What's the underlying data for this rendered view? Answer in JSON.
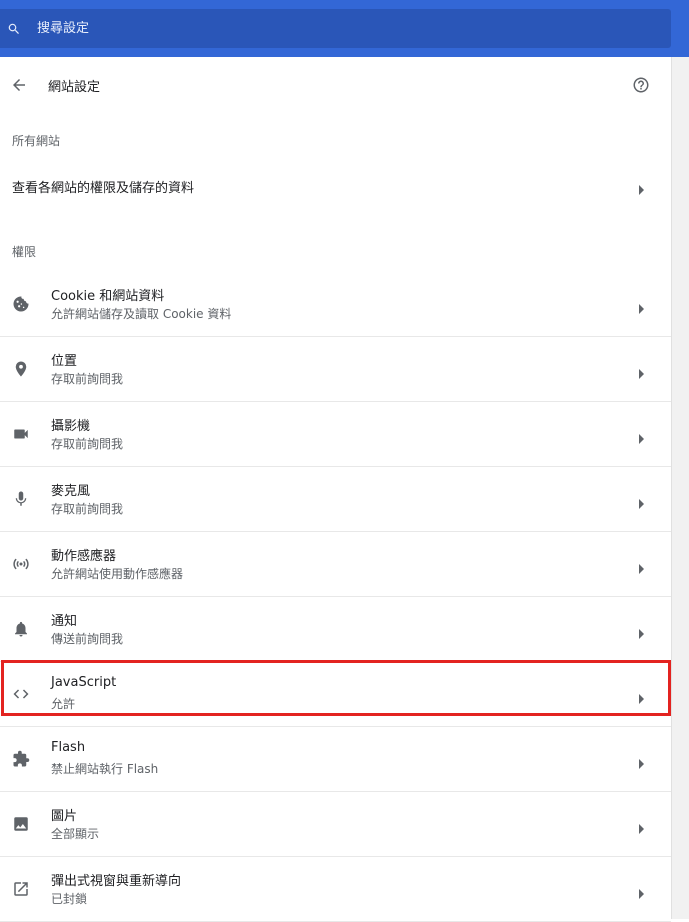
{
  "search": {
    "placeholder": "搜尋設定"
  },
  "header": {
    "title": "網站設定"
  },
  "sections": {
    "all_sites": {
      "label": "所有網站",
      "link_label": "查看各網站的權限及儲存的資料"
    },
    "permissions": {
      "label": "權限"
    }
  },
  "permissions": [
    {
      "icon": "cookie-icon",
      "title": "Cookie 和網站資料",
      "subtitle": "允許網站儲存及讀取 Cookie 資料"
    },
    {
      "icon": "location-pin-icon",
      "title": "位置",
      "subtitle": "存取前詢問我"
    },
    {
      "icon": "camera-icon",
      "title": "攝影機",
      "subtitle": "存取前詢問我"
    },
    {
      "icon": "microphone-icon",
      "title": "麥克風",
      "subtitle": "存取前詢問我"
    },
    {
      "icon": "motion-sensor-icon",
      "title": "動作感應器",
      "subtitle": "允許網站使用動作感應器"
    },
    {
      "icon": "bell-icon",
      "title": "通知",
      "subtitle": "傳送前詢問我"
    },
    {
      "icon": "code-icon",
      "title": "JavaScript",
      "subtitle": "允許"
    },
    {
      "icon": "puzzle-icon",
      "title": "Flash",
      "subtitle": "禁止網站執行 Flash"
    },
    {
      "icon": "image-icon",
      "title": "圖片",
      "subtitle": "全部顯示"
    },
    {
      "icon": "popup-icon",
      "title": "彈出式視窗與重新導向",
      "subtitle": "已封鎖"
    }
  ],
  "colors": {
    "topbar": "#3367d6",
    "search_field": "#2a56b8",
    "highlight": "#e32320"
  }
}
